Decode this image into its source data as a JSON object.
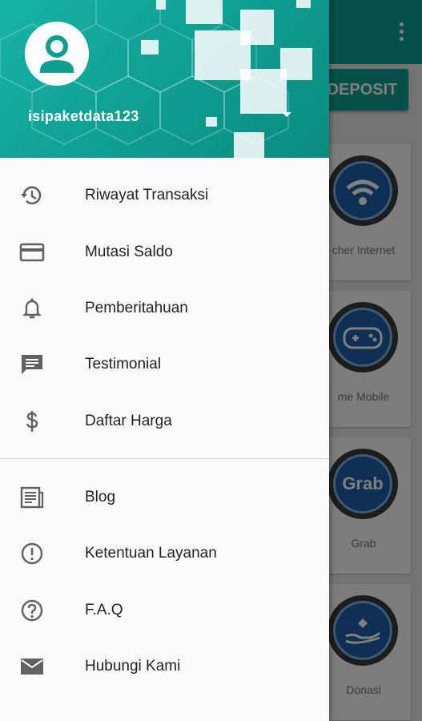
{
  "background": {
    "deposit_label": "DEPOSIT",
    "cards": [
      {
        "label": "cher Internet",
        "icon": "wifi-icon"
      },
      {
        "label": "me Mobile",
        "icon": "gamepad-icon"
      },
      {
        "label": "Grab",
        "icon": "grab-logo-icon",
        "logo_text": "Grab"
      },
      {
        "label": "Donasi",
        "icon": "donation-icon"
      }
    ]
  },
  "drawer": {
    "username": "isipaketdata123",
    "menu_primary": [
      {
        "label": "Riwayat Transaksi",
        "icon": "history-icon"
      },
      {
        "label": "Mutasi Saldo",
        "icon": "credit-card-icon"
      },
      {
        "label": "Pemberitahuan",
        "icon": "bell-icon"
      },
      {
        "label": "Testimonial",
        "icon": "comment-icon"
      },
      {
        "label": "Daftar Harga",
        "icon": "dollar-icon"
      }
    ],
    "menu_secondary": [
      {
        "label": "Blog",
        "icon": "article-icon"
      },
      {
        "label": "Ketentuan Layanan",
        "icon": "alert-circle-icon"
      },
      {
        "label": "F.A.Q",
        "icon": "help-circle-icon"
      },
      {
        "label": "Hubungi Kami",
        "icon": "mail-icon"
      }
    ]
  },
  "colors": {
    "primary": "#0e9f92",
    "drawer_bg": "#fafafa",
    "icon_gray": "#616161"
  }
}
